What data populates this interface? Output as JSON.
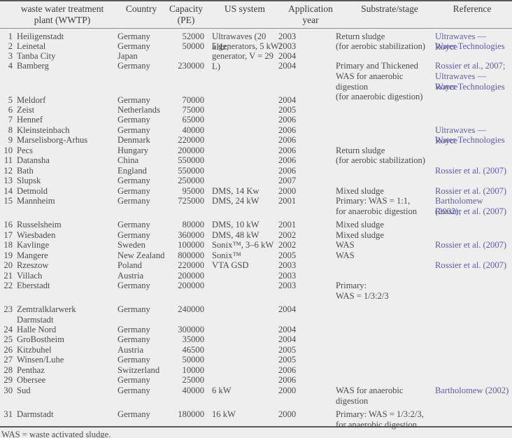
{
  "table": {
    "headers": {
      "index": "",
      "plant": "waste water treatment\nplant (WWTP)",
      "country": "Country",
      "capacity": "Capacity\n(PE)",
      "us_system": "US system",
      "application_year": "Application\nyear",
      "substrate": "Substrate/stage",
      "reference": "Reference"
    },
    "link_color": "#5c5ca8",
    "rows": [
      {
        "index": "1",
        "plant": "Heiligenstadt",
        "country": "Germany",
        "capacity": "52000",
        "us_system": "Ultrawaves (20 kHz,",
        "year": "2003",
        "substrate": "Return sludge",
        "reference": "Ultrawaves — Royce"
      },
      {
        "index": "2",
        "plant": "Leinetal",
        "country": "Germany",
        "capacity": "50000",
        "us_system": "5 generators, 5 kW/",
        "year": "2003",
        "substrate": "(for aerobic stabilization)",
        "reference": "Water Technologies"
      },
      {
        "index": "3",
        "plant": "Tanba City",
        "country": "Japan",
        "capacity": "",
        "us_system": "generator, V = 29 L)",
        "year": "2004",
        "substrate": "",
        "reference": ""
      },
      {
        "index": "4",
        "plant": "Bamberg",
        "country": "Germany",
        "capacity": "230000",
        "us_system": "",
        "year": "2004",
        "substrate": "Primary and Thickened",
        "reference": "Rossier et al., 2007;"
      },
      {
        "index": "5",
        "plant": "Meldorf",
        "country": "Germany",
        "capacity": "70000",
        "us_system": "",
        "year": "2004",
        "substrate": "",
        "reference": ""
      },
      {
        "index": "6",
        "plant": "Zeist",
        "country": "Netherlands",
        "capacity": "75000",
        "us_system": "",
        "year": "2005",
        "substrate": "",
        "reference": ""
      },
      {
        "index": "7",
        "plant": "Hennef",
        "country": "Germany",
        "capacity": "65000",
        "us_system": "",
        "year": "2006",
        "substrate": "",
        "reference": ""
      },
      {
        "index": "8",
        "plant": "Kleinsteinbach",
        "country": "Germany",
        "capacity": "40000",
        "us_system": "",
        "year": "2006",
        "substrate": "",
        "reference": "Ultrawaves — Royce"
      },
      {
        "index": "9",
        "plant": "Marselisborg-Arhus",
        "country": "Denmark",
        "capacity": "220000",
        "us_system": "",
        "year": "2006",
        "substrate": "",
        "reference": "Water Technologies"
      },
      {
        "index": "10",
        "plant": "Pecs",
        "country": "Hungary",
        "capacity": "200000",
        "us_system": "",
        "year": "2006",
        "substrate": "Return sludge",
        "reference": ""
      },
      {
        "index": "11",
        "plant": "Datansha",
        "country": "China",
        "capacity": "550000",
        "us_system": "",
        "year": "2006",
        "substrate": "(for aerobic stabilization)",
        "reference": ""
      },
      {
        "index": "12",
        "plant": "Bath",
        "country": "England",
        "capacity": "550000",
        "us_system": "",
        "year": "2006",
        "substrate": "",
        "reference": "Rossier et al. (2007)"
      },
      {
        "index": "13",
        "plant": "Slupsk",
        "country": "Germany",
        "capacity": "250000",
        "us_system": "",
        "year": "2007",
        "substrate": "",
        "reference": ""
      },
      {
        "index": "14",
        "plant": "Detmold",
        "country": "Germany",
        "capacity": "95000",
        "us_system": "DMS, 14 Kw",
        "year": "2000",
        "substrate": "Mixed sludge",
        "reference": "Rossier et al. (2007)"
      },
      {
        "index": "15",
        "plant": "Mannheim",
        "country": "Germany",
        "capacity": "725000",
        "us_system": "DMS, 24 kW",
        "year": "2001",
        "substrate": "Primary: WAS = 1:1,",
        "reference": "Bartholomew (2002);"
      },
      {
        "index": "16",
        "plant": "Russelsheim",
        "country": "Germany",
        "capacity": "80000",
        "us_system": "DMS, 10 kW",
        "year": "2001",
        "substrate": "Mixed sludge",
        "reference": ""
      },
      {
        "index": "17",
        "plant": "Wiesbaden",
        "country": "Germany",
        "capacity": "360000",
        "us_system": "DMS, 48 kW",
        "year": "2002",
        "substrate": "Mixed sludge",
        "reference": ""
      },
      {
        "index": "18",
        "plant": "Kavlinge",
        "country": "Sweden",
        "capacity": "100000",
        "us_system": "Sonix™, 3–6 kW",
        "year": "2002",
        "substrate": "WAS",
        "reference": "Rossier et al. (2007)"
      },
      {
        "index": "19",
        "plant": "Mangere",
        "country": "New Zealand",
        "capacity": "800000",
        "us_system": "Sonix™",
        "year": "2005",
        "substrate": "WAS",
        "reference": ""
      },
      {
        "index": "20",
        "plant": "Rzeszow",
        "country": "Poland",
        "capacity": "220000",
        "us_system": "VTA GSD",
        "year": "2003",
        "substrate": "",
        "reference": "Rossier et al. (2007)"
      },
      {
        "index": "21",
        "plant": "Villach",
        "country": "Austria",
        "capacity": "200000",
        "us_system": "",
        "year": "2003",
        "substrate": "",
        "reference": ""
      },
      {
        "index": "22",
        "plant": "Eberstadt",
        "country": "Germany",
        "capacity": "200000",
        "us_system": "",
        "year": "2003",
        "substrate": "Primary:",
        "reference": ""
      },
      {
        "index": "23",
        "plant": "Zemtralklarwerk\nDarmstadt",
        "country": "Germany",
        "capacity": "240000",
        "us_system": "",
        "year": "2004",
        "substrate": "",
        "reference": ""
      },
      {
        "index": "24",
        "plant": "Halle Nord",
        "country": "Germany",
        "capacity": "300000",
        "us_system": "",
        "year": "2004",
        "substrate": "",
        "reference": ""
      },
      {
        "index": "25",
        "plant": "GroBostheim",
        "country": "Germany",
        "capacity": "35000",
        "us_system": "",
        "year": "2004",
        "substrate": "",
        "reference": ""
      },
      {
        "index": "26",
        "plant": "Kitzbuhel",
        "country": "Austria",
        "capacity": "46500",
        "us_system": "",
        "year": "2005",
        "substrate": "",
        "reference": ""
      },
      {
        "index": "27",
        "plant": "Winsen/Luhe",
        "country": "Germany",
        "capacity": "50000",
        "us_system": "",
        "year": "2005",
        "substrate": "",
        "reference": ""
      },
      {
        "index": "28",
        "plant": "Penthaz",
        "country": "Switzerland",
        "capacity": "10000",
        "us_system": "",
        "year": "2006",
        "substrate": "",
        "reference": ""
      },
      {
        "index": "29",
        "plant": "Obersee",
        "country": "Germany",
        "capacity": "25000",
        "us_system": "",
        "year": "2006",
        "substrate": "",
        "reference": ""
      },
      {
        "index": "30",
        "plant": "Sud",
        "country": "Germany",
        "capacity": "40000",
        "us_system": "6 kW",
        "year": "2000",
        "substrate": "WAS for anaerobic",
        "reference": "Bartholomew (2002)"
      },
      {
        "index": "31",
        "plant": "Darmstadt",
        "country": "Germany",
        "capacity": "180000",
        "us_system": "16 kW",
        "year": "2000",
        "substrate": "Primary: WAS = 1/3:2/3,",
        "reference": ""
      }
    ],
    "substrate_extra_lines": {
      "row4_line2": "WAS for anaerobic",
      "row4_line3": "digestion",
      "row4_line4": "(for anaerobic digestion)",
      "row15_line2": "for anaerobic digestion",
      "row22_line2": "WAS = 1/3:2/3",
      "row30_line2": "digestion",
      "row31_line2": "for anaerobic digestion"
    },
    "reference_extra_lines": {
      "row4_line2": "Ultrawaves — Royce",
      "row4_line3": "Water Technologies",
      "row15_line2": "Rossier et al. (2007)"
    },
    "footnote": "WAS = waste activated sludge."
  }
}
